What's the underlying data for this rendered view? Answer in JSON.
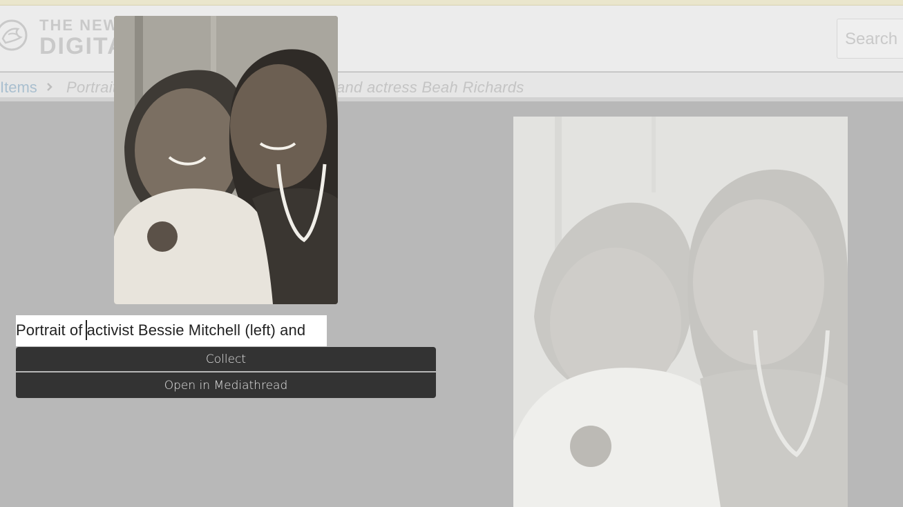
{
  "header": {
    "logo_line1": "THE NEW",
    "logo_line2": "DIGITA",
    "search_placeholder": "Search"
  },
  "breadcrumb": {
    "items_label": "Items",
    "title": "Portrait of activist Bessie Mitchell (left) and actress Beah Richards"
  },
  "editor": {
    "title_value": "Portrait of activist Bessie Mitchell (left) and",
    "collect_label": "Collect",
    "mediathread_label": "Open in Mediathread"
  },
  "colors": {
    "page_bg": "#b8b8b8",
    "button_bg": "#333333",
    "button_text": "#e6e6e6"
  }
}
